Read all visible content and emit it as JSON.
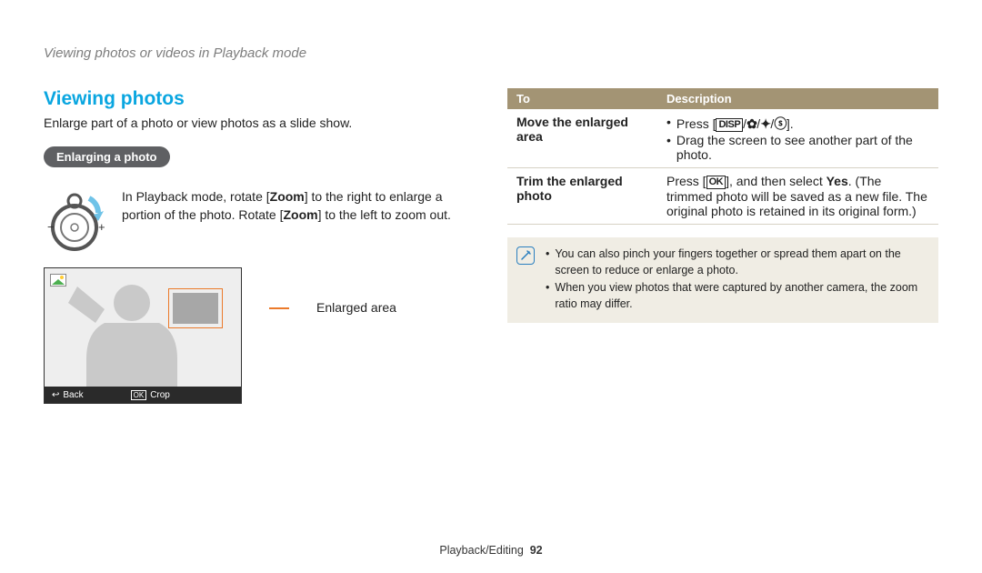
{
  "breadcrumb": "Viewing photos or videos in Playback mode",
  "section_title": "Viewing photos",
  "intro": "Enlarge part of a photo or view photos as a slide show.",
  "pill": "Enlarging a photo",
  "zoom_text_pre": "In Playback mode, rotate [",
  "zoom_text_word1": "Zoom",
  "zoom_text_mid": "] to the right to enlarge a portion of the photo. Rotate [",
  "zoom_text_word2": "Zoom",
  "zoom_text_post": "] to the left to zoom out.",
  "screen": {
    "back": "Back",
    "ok": "OK",
    "crop": "Crop"
  },
  "legend": "Enlarged area",
  "table": {
    "h1": "To",
    "h2": "Description",
    "r1c1": "Move the enlarged area",
    "r1_b1_pre": "Press [",
    "r1_b1_disp": "DISP",
    "r1_b1_post": "].",
    "r1_b2": "Drag the screen to see another part of the photo.",
    "r2c1": "Trim the enlarged photo",
    "r2_pre": "Press [",
    "r2_ok": "OK",
    "r2_mid": "], and then select ",
    "r2_yes": "Yes",
    "r2_post": ". (The trimmed photo will be saved as a new file. The original photo is retained in its original form.)"
  },
  "note": {
    "n1": "You can also pinch your fingers together or spread them apart on the screen to reduce or enlarge a photo.",
    "n2": "When you view photos that were captured by another camera, the zoom ratio may differ."
  },
  "footer": {
    "section": "Playback/Editing",
    "page": "92"
  }
}
